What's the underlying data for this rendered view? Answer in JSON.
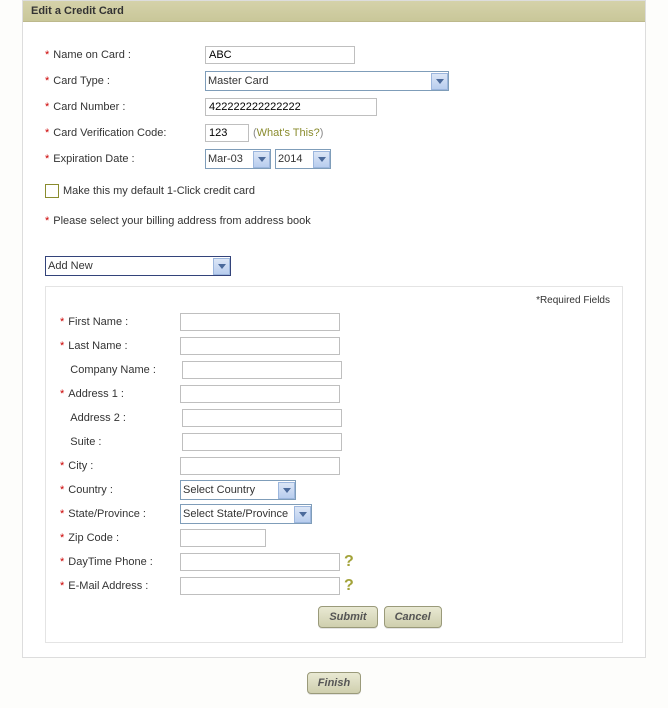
{
  "header": {
    "title": "Edit a Credit Card"
  },
  "card": {
    "name_on_card_label": "Name on Card :",
    "name_on_card_value": "ABC",
    "card_type_label": "Card Type :",
    "card_type_value": "Master Card",
    "card_number_label": "Card Number :",
    "card_number_value": "422222222222222",
    "cvv_label": "Card Verification Code:",
    "cvv_value": "123",
    "whats_this": "What's This?",
    "exp_label": "Expiration Date :",
    "exp_month": "Mar-03",
    "exp_year": "2014",
    "default_label": "Make this my default 1-Click credit card",
    "billing_select_label": "Please select your billing address from address book",
    "addr_dropdown": "Add New"
  },
  "required_fields": "*Required Fields",
  "addr": {
    "first_name": "First Name :",
    "last_name": "Last Name :",
    "company": "Company Name :",
    "address1": "Address 1 :",
    "address2": "Address 2 :",
    "suite": "Suite :",
    "city": "City :",
    "country": "Country :",
    "country_value": "Select Country",
    "state": "State/Province :",
    "state_value": "Select State/Province",
    "zip": "Zip Code :",
    "day_phone": "DayTime Phone :",
    "email": "E-Mail Address :"
  },
  "buttons": {
    "submit": "Submit",
    "cancel": "Cancel",
    "finish": "Finish"
  }
}
